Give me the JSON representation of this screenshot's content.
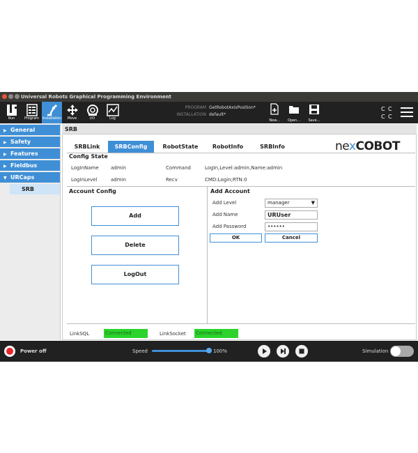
{
  "window": {
    "title": "Universal Robots Graphical Programming Environment"
  },
  "toolbar": {
    "items": [
      {
        "label": "Run"
      },
      {
        "label": "Program"
      },
      {
        "label": "Installation"
      },
      {
        "label": "Move"
      },
      {
        "label": "I/O"
      },
      {
        "label": "Log"
      }
    ],
    "program_label": "PROGRAM",
    "program_value": "GetRobotAxisPosition*",
    "installation_label": "INSTALLATION",
    "installation_value": "default*",
    "file_buttons": [
      {
        "label": "New..."
      },
      {
        "label": "Open..."
      },
      {
        "label": "Save..."
      }
    ]
  },
  "sidebar": {
    "items": [
      {
        "label": "General"
      },
      {
        "label": "Safety"
      },
      {
        "label": "Features"
      },
      {
        "label": "Fieldbus"
      },
      {
        "label": "URCaps"
      }
    ],
    "subitem": "SRB"
  },
  "main": {
    "header": "SRB",
    "tabs": [
      "SRBLink",
      "SRBConfig",
      "RobotState",
      "RobotInfo",
      "SRBInfo"
    ],
    "active_tab": "SRBConfig",
    "logo": {
      "ne": "ne",
      "x": "x",
      "cobot": "COBOT"
    },
    "config_state": {
      "title": "Config State",
      "login_name_label": "LogInName",
      "login_name_value": "admin",
      "command_label": "Command",
      "command_value": "LogIn,Level:admin,Name:admin",
      "login_level_label": "LogInLevel",
      "login_level_value": "admin",
      "recv_label": "Recv",
      "recv_value": "CMD:Login;RTN:0"
    },
    "account_config": {
      "title": "Account Config",
      "buttons": [
        "Add",
        "Delete",
        "LogOut"
      ]
    },
    "add_account": {
      "title": "Add Account",
      "level_label": "Add Level",
      "level_value": "manager",
      "name_label": "Add Name",
      "name_value": "URUser",
      "password_label": "Add Password",
      "password_value": "••••••",
      "ok_label": "OK",
      "cancel_label": "Cancel"
    },
    "links": {
      "sql_label": "LinkSQL",
      "sql_status": "Connected",
      "socket_label": "LinkSocket",
      "socket_status": "Connected"
    }
  },
  "bottom": {
    "power_label": "Power off",
    "speed_label": "Speed",
    "speed_value": "100%",
    "speed_fraction": 1.0,
    "simulation_label": "Simulation"
  },
  "colors": {
    "accent": "#3f8fd6",
    "connected": "#2bd32b",
    "power": "#e8262b"
  }
}
